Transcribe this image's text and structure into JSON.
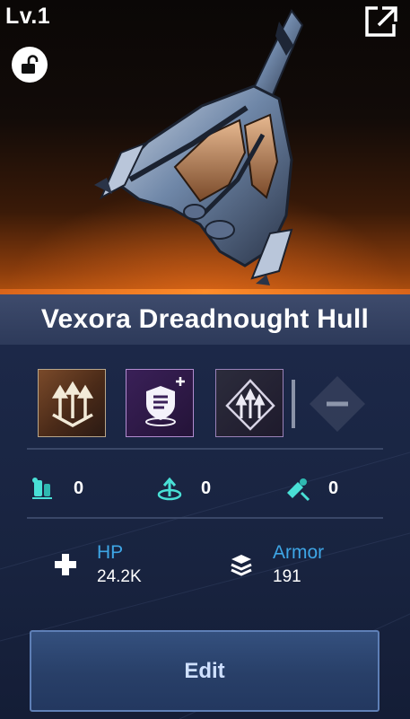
{
  "header": {
    "level": "Lv.1"
  },
  "title": "Vexora Dreadnought Hull",
  "stats": [
    {
      "icon": "ammo-icon",
      "value": "0"
    },
    {
      "icon": "upgrade-icon",
      "value": "0"
    },
    {
      "icon": "repair-icon",
      "value": "0"
    }
  ],
  "attributes": {
    "hp": {
      "label": "HP",
      "value": "24.2K",
      "icon": "cross-icon"
    },
    "armor": {
      "label": "Armor",
      "value": "191",
      "icon": "armor-layers-icon"
    }
  },
  "actions": {
    "edit_label": "Edit"
  },
  "colors": {
    "accent_orange": "#ff8c2a",
    "label_blue": "#3ea6e6",
    "panel_bg": "#18233f"
  }
}
